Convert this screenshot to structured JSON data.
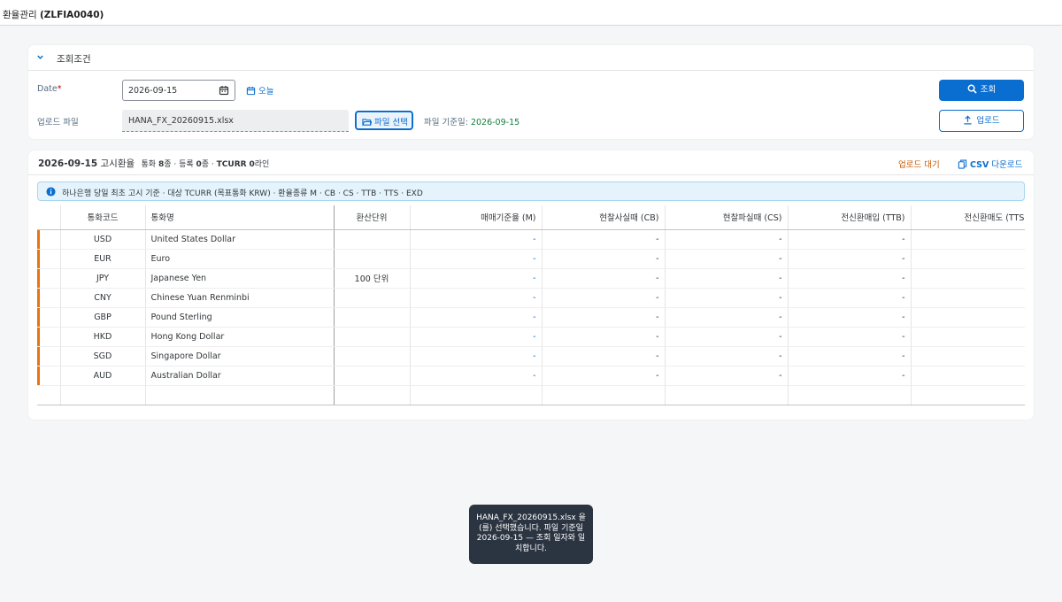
{
  "header": {
    "title_prefix": "환율관리",
    "title_code": "(ZLFIA0040)"
  },
  "criteria": {
    "section_title": "조회조건",
    "date_label": "Date",
    "date_required_mark": "*",
    "date_value": "2026-09-15",
    "today_label": "오늘",
    "upload_label": "업로드 파일",
    "file_value": "HANA_FX_20260915.xlsx",
    "file_select_label": "파일 선택",
    "file_date_label": "파일 기준일:",
    "file_date_value": "2026-09-15",
    "search_label": "조회",
    "upload_button_label": "업로드"
  },
  "table_panel": {
    "date": "2026-09-15",
    "title": "고시환율",
    "summary_currency_prefix": "통화",
    "summary_currency_count": "8",
    "summary_currency_suffix": "종 · 등록",
    "summary_registered_count": "0",
    "summary_registered_suffix": "종 ·",
    "summary_tcurr_prefix": "TCURR",
    "summary_tcurr_count": "0",
    "summary_tcurr_suffix": "라인",
    "upload_status": "업로드 대기",
    "csv_prefix": "CSV",
    "csv_suffix": "다운로드",
    "info_text": "하나은행 당일 최초 고시 기준 · 대상 TCURR (목표통화 KRW) · 환율종류 M · CB · CS · TTB · TTS · EXD",
    "columns": [
      "통화코드",
      "통화명",
      "환산단위",
      "매매기준율 (M)",
      "현찰사실때 (CB)",
      "현찰파실때 (CS)",
      "전신환매입 (TTB)",
      "전신환매도 (TTS"
    ],
    "rows": [
      {
        "code": "USD",
        "name": "United States Dollar",
        "unit": "",
        "m": "-",
        "cb": "-",
        "cs": "-",
        "ttb": "-",
        "tts": ""
      },
      {
        "code": "EUR",
        "name": "Euro",
        "unit": "",
        "m": "-",
        "cb": "-",
        "cs": "-",
        "ttb": "-",
        "tts": ""
      },
      {
        "code": "JPY",
        "name": "Japanese Yen",
        "unit": "100 단위",
        "m": "-",
        "cb": "-",
        "cs": "-",
        "ttb": "-",
        "tts": ""
      },
      {
        "code": "CNY",
        "name": "Chinese Yuan Renminbi",
        "unit": "",
        "m": "-",
        "cb": "-",
        "cs": "-",
        "ttb": "-",
        "tts": ""
      },
      {
        "code": "GBP",
        "name": "Pound Sterling",
        "unit": "",
        "m": "-",
        "cb": "-",
        "cs": "-",
        "ttb": "-",
        "tts": ""
      },
      {
        "code": "HKD",
        "name": "Hong Kong Dollar",
        "unit": "",
        "m": "-",
        "cb": "-",
        "cs": "-",
        "ttb": "-",
        "tts": ""
      },
      {
        "code": "SGD",
        "name": "Singapore Dollar",
        "unit": "",
        "m": "-",
        "cb": "-",
        "cs": "-",
        "ttb": "-",
        "tts": ""
      },
      {
        "code": "AUD",
        "name": "Australian Dollar",
        "unit": "",
        "m": "-",
        "cb": "-",
        "cs": "-",
        "ttb": "-",
        "tts": ""
      }
    ]
  },
  "toast": {
    "message": "HANA_FX_20260915.xlsx 을(를) 선택했습니다. 파일 기준일 2026-09-15 — 조회 일자와 일치합니다."
  },
  "colors": {
    "accent": "#0a6ed1",
    "row_marker": "#e9730c",
    "status_warning": "#c65a00",
    "positive": "#107e3e",
    "toast_bg": "#2b3441"
  }
}
